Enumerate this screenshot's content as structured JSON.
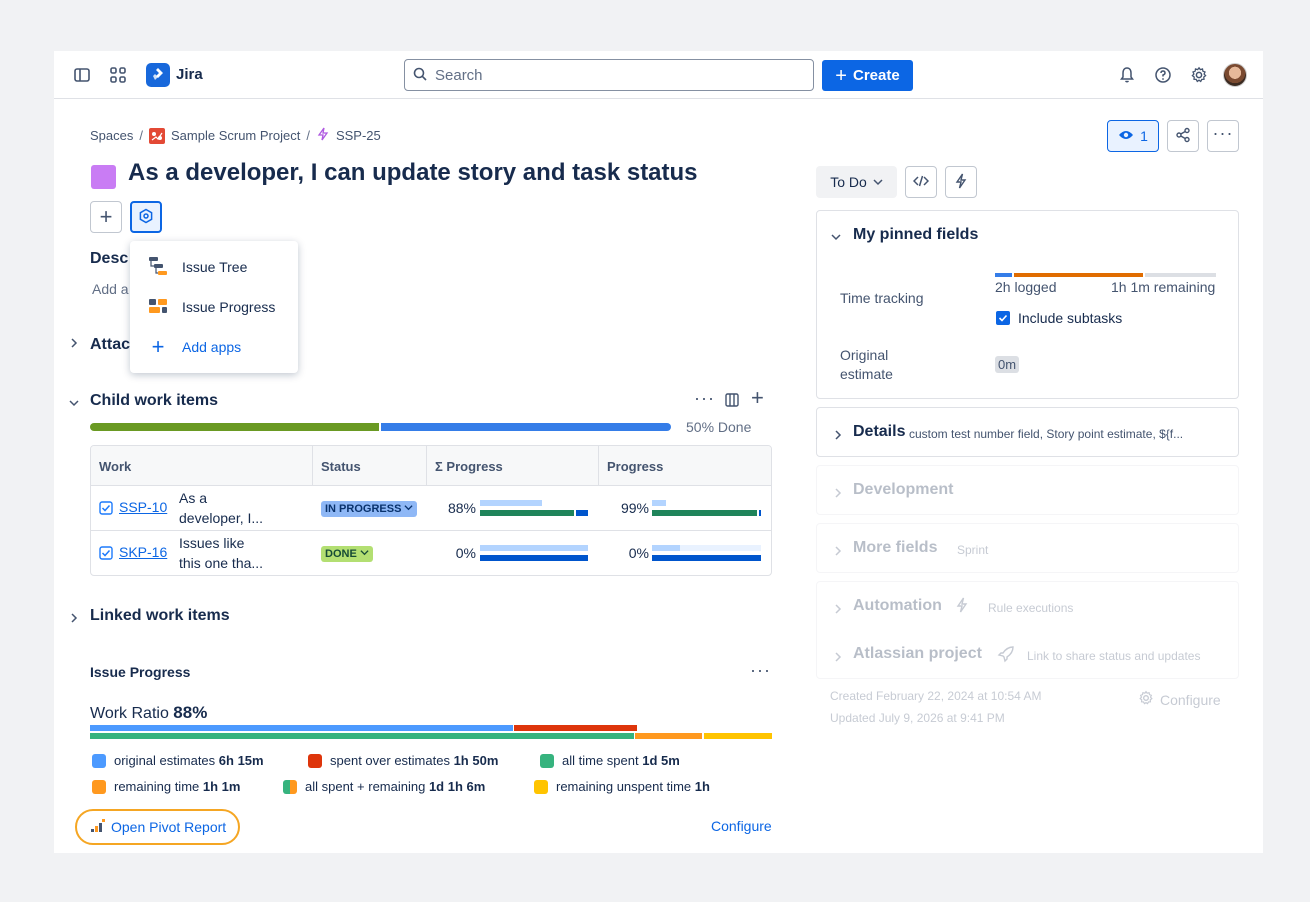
{
  "topbar": {
    "app_name": "Jira",
    "search_placeholder": "Search",
    "create_label": "Create",
    "brand_color": "#0c66e4"
  },
  "breadcrumb": {
    "spaces": "Spaces",
    "project": "Sample Scrum Project",
    "issue_key": "SSP-25",
    "separator": "/"
  },
  "issue": {
    "title": "As a developer, I can update story and task status",
    "watch_count": "1"
  },
  "apps_menu": {
    "items": [
      {
        "label": "Issue Tree",
        "icon": "issue-tree-icon"
      },
      {
        "label": "Issue Progress",
        "icon": "issue-progress-icon"
      },
      {
        "label": "Add apps",
        "icon": "plus-icon"
      }
    ]
  },
  "sections": {
    "description_partial": "Desc",
    "description_placeholder_partial": "Add a",
    "attachments_partial": "Attac",
    "child_work_items": "Child work items",
    "child_done": "50% Done",
    "linked_work_items": "Linked work items"
  },
  "child_table": {
    "headers": [
      "Work",
      "Status",
      "Σ Progress",
      "Progress"
    ],
    "rows": [
      {
        "key": "SSP-10",
        "summary_line1": "As a",
        "summary_line2": "developer, I...",
        "status": "IN PROGRESS",
        "sigma_progress": "88%",
        "progress": "99%",
        "sigma_fraction": 0.88,
        "progress_fraction": 0.99
      },
      {
        "key": "SKP-16",
        "summary_line1": "Issues like",
        "summary_line2": "this one tha...",
        "status": "DONE",
        "sigma_progress": "0%",
        "progress": "0%",
        "sigma_fraction": 0.0,
        "progress_fraction": 0.0
      }
    ]
  },
  "issue_progress": {
    "title": "Issue Progress",
    "work_ratio_label": "Work Ratio",
    "work_ratio_value": "88%",
    "legend": [
      {
        "label": "original estimates",
        "value": "6h 15m",
        "color": "#4c9aff"
      },
      {
        "label": "spent over estimates",
        "value": "1h 50m",
        "color": "#de350b"
      },
      {
        "label": "all time spent",
        "value": "1d 5m",
        "color": "#36b37e"
      },
      {
        "label": "remaining time",
        "value": "1h 1m",
        "color": "#ff991f"
      },
      {
        "label": "all spent + remaining",
        "value": "1d 1h 6m",
        "color": "#36b37e"
      },
      {
        "label": "remaining unspent time",
        "value": "1h",
        "color": "#ffc400"
      }
    ],
    "open_pivot": "Open Pivot Report",
    "configure": "Configure"
  },
  "right_panel": {
    "status": "To Do",
    "pinned_title": "My pinned fields",
    "time_tracking_label": "Time tracking",
    "logged": "2h logged",
    "remaining": "1h 1m remaining",
    "include_subtasks": "Include subtasks",
    "original_estimate_label_1": "Original",
    "original_estimate_label_2": "estimate",
    "original_estimate_value": "0m",
    "details_title": "Details",
    "details_hint": "custom test number field, Story point estimate, ${f...",
    "development": "Development",
    "more_fields": "More fields",
    "more_fields_hint": "Sprint",
    "automation": "Automation",
    "automation_hint": "Rule executions",
    "atlassian_project": "Atlassian project",
    "atlassian_hint": "Link to share status and updates",
    "created": "Created February 22, 2024 at 10:54 AM",
    "updated": "Updated July 9, 2026 at 9:41 PM",
    "configure": "Configure"
  }
}
